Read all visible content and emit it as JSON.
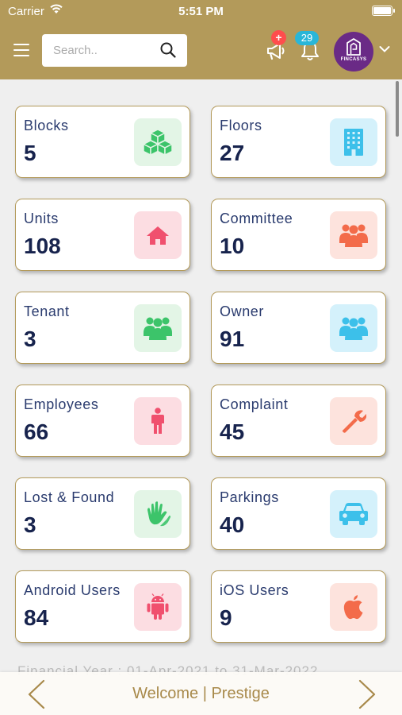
{
  "status_bar": {
    "carrier": "Carrier",
    "time": "5:51 PM"
  },
  "header": {
    "search_placeholder": "Search..",
    "announcement_badge": "+",
    "notification_count": "29",
    "avatar_text": "FINCASYS"
  },
  "cards": [
    {
      "label": "Blocks",
      "value": "5",
      "icon": "cubes-icon",
      "icon_bg": "#e3f5e6",
      "icon_color": "#3cc46a"
    },
    {
      "label": "Floors",
      "value": "27",
      "icon": "building-icon",
      "icon_bg": "#d4f1fb",
      "icon_color": "#3cc0ea"
    },
    {
      "label": "Units",
      "value": "108",
      "icon": "home-icon",
      "icon_bg": "#fcdde2",
      "icon_color": "#f0506e"
    },
    {
      "label": "Committee",
      "value": "10",
      "icon": "group-icon",
      "icon_bg": "#fde3dd",
      "icon_color": "#f36b4a"
    },
    {
      "label": "Tenant",
      "value": "3",
      "icon": "group-icon",
      "icon_bg": "#e3f5e6",
      "icon_color": "#3cc46a"
    },
    {
      "label": "Owner",
      "value": "91",
      "icon": "group-icon",
      "icon_bg": "#d4f1fb",
      "icon_color": "#3cc0ea"
    },
    {
      "label": "Employees",
      "value": "66",
      "icon": "person-icon",
      "icon_bg": "#fcdde2",
      "icon_color": "#f0506e"
    },
    {
      "label": "Complaint",
      "value": "45",
      "icon": "wrench-icon",
      "icon_bg": "#fde3dd",
      "icon_color": "#f36b4a"
    },
    {
      "label": "Lost & Found",
      "value": "3",
      "icon": "hands-icon",
      "icon_bg": "#e3f5e6",
      "icon_color": "#3cc46a"
    },
    {
      "label": "Parkings",
      "value": "40",
      "icon": "car-icon",
      "icon_bg": "#d4f1fb",
      "icon_color": "#3cc0ea"
    },
    {
      "label": "Android Users",
      "value": "84",
      "icon": "android-icon",
      "icon_bg": "#fcdde2",
      "icon_color": "#f0506e"
    },
    {
      "label": "iOS Users",
      "value": "9",
      "icon": "apple-icon",
      "icon_bg": "#fde3dd",
      "icon_color": "#f36b4a"
    }
  ],
  "footer_partial_text": "Financial Year : 01-Apr-2021 to 31-Mar-2022",
  "footer": {
    "welcome_text": "Welcome | Prestige"
  },
  "colors": {
    "primary": "#b39a5a",
    "label": "#2a3b6e",
    "value": "#17234d"
  }
}
